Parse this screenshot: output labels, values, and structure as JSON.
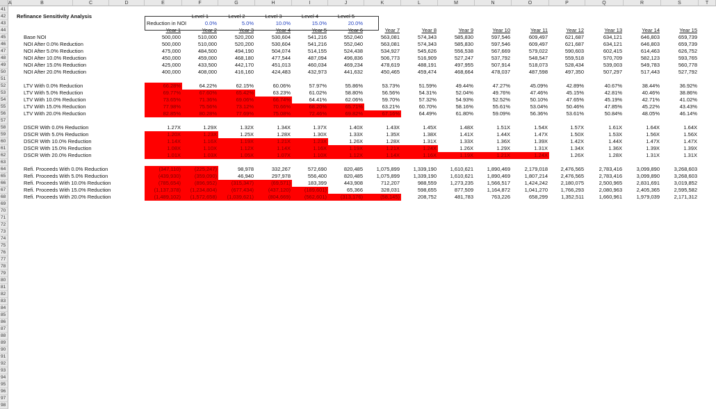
{
  "columns": [
    "A",
    "B",
    "C",
    "D",
    "E",
    "F",
    "G",
    "H",
    "I",
    "J",
    "K",
    "L",
    "M",
    "N",
    "O",
    "P",
    "Q",
    "R",
    "S",
    "T"
  ],
  "row_numbers": [
    41,
    42,
    43,
    44,
    45,
    46,
    47,
    48,
    49,
    50,
    51,
    52,
    53,
    54,
    55,
    56,
    57,
    58,
    59,
    60,
    61,
    62,
    63,
    64,
    65,
    66,
    67,
    68,
    69,
    70,
    71,
    72,
    73,
    74,
    75,
    76,
    77,
    78,
    79,
    80,
    81,
    82,
    83,
    84,
    85,
    86,
    87,
    88,
    89,
    90,
    91,
    92,
    93,
    94,
    95,
    96,
    97,
    98
  ],
  "title": "Refinance Sensitivity Analysis",
  "levels": [
    "Level 1",
    "Level 2",
    "Level 3",
    "Level 4",
    "Level 5"
  ],
  "reduction_label": "Reduction in NOI",
  "reduction_values": [
    "0.0%",
    "5.0%",
    "10.0%",
    "15.0%",
    "20.0%"
  ],
  "years": [
    "Year 1",
    "Year 2",
    "Year 3",
    "Year 4",
    "Year 5",
    "Year 6",
    "Year 7",
    "Year 8",
    "Year 9",
    "Year 10",
    "Year 11",
    "Year 12",
    "Year 13",
    "Year 14",
    "Year 15"
  ],
  "sections": [
    {
      "rows": [
        {
          "label": "Base NOI",
          "values": [
            "500,000",
            "510,000",
            "520,200",
            "530,604",
            "541,216",
            "552,040",
            "563,081",
            "574,343",
            "585,830",
            "597,546",
            "609,497",
            "621,687",
            "634,121",
            "646,803",
            "659,739"
          ],
          "hl": 0
        },
        {
          "label": "NOI After 0.0% Reduction",
          "values": [
            "500,000",
            "510,000",
            "520,200",
            "530,604",
            "541,216",
            "552,040",
            "563,081",
            "574,343",
            "585,830",
            "597,546",
            "609,497",
            "621,687",
            "634,121",
            "646,803",
            "659,739"
          ],
          "hl": 0
        },
        {
          "label": "NOI After 5.0% Reduction",
          "values": [
            "475,000",
            "484,500",
            "494,190",
            "504,074",
            "514,155",
            "524,438",
            "534,927",
            "545,626",
            "556,538",
            "567,669",
            "579,022",
            "590,603",
            "602,415",
            "614,463",
            "626,752"
          ],
          "hl": 0
        },
        {
          "label": "NOI After 10.0% Reduction",
          "values": [
            "450,000",
            "459,000",
            "468,180",
            "477,544",
            "487,094",
            "496,836",
            "506,773",
            "516,909",
            "527,247",
            "537,792",
            "548,547",
            "559,518",
            "570,709",
            "582,123",
            "593,765"
          ],
          "hl": 0
        },
        {
          "label": "NOI After 15.0% Reduction",
          "values": [
            "425,000",
            "433,500",
            "442,170",
            "451,013",
            "460,034",
            "469,234",
            "478,619",
            "488,191",
            "497,955",
            "507,914",
            "518,073",
            "528,434",
            "539,003",
            "549,783",
            "560,778"
          ],
          "hl": 0
        },
        {
          "label": "NOI After 20.0% Reduction",
          "values": [
            "400,000",
            "408,000",
            "416,160",
            "424,483",
            "432,973",
            "441,632",
            "450,465",
            "459,474",
            "468,664",
            "478,037",
            "487,598",
            "497,350",
            "507,297",
            "517,443",
            "527,792"
          ],
          "hl": 0
        }
      ]
    },
    {
      "rows": [
        {
          "label": "LTV With 0.0% Reduction",
          "values": [
            "66.28%",
            "64.22%",
            "62.15%",
            "60.06%",
            "57.97%",
            "55.86%",
            "53.73%",
            "51.59%",
            "49.44%",
            "47.27%",
            "45.09%",
            "42.89%",
            "40.67%",
            "38.44%",
            "36.92%"
          ],
          "hl": 1
        },
        {
          "label": "LTV With 5.0% Reduction",
          "values": [
            "69.77%",
            "67.60%",
            "65.42%",
            "63.23%",
            "61.02%",
            "58.80%",
            "56.56%",
            "54.31%",
            "52.04%",
            "49.76%",
            "47.46%",
            "45.15%",
            "42.81%",
            "40.46%",
            "38.86%"
          ],
          "hl": 3
        },
        {
          "label": "LTV With 10.0% Reduction",
          "values": [
            "73.65%",
            "71.36%",
            "69.06%",
            "66.74%",
            "64.41%",
            "62.06%",
            "59.70%",
            "57.32%",
            "54.93%",
            "52.52%",
            "50.10%",
            "47.65%",
            "45.19%",
            "42.71%",
            "41.02%"
          ],
          "hl": 4
        },
        {
          "label": "LTV With 15.0% Reduction",
          "values": [
            "77.98%",
            "75.56%",
            "73.12%",
            "70.66%",
            "68.20%",
            "65.71%",
            "63.21%",
            "60.70%",
            "58.16%",
            "55.61%",
            "53.04%",
            "50.46%",
            "47.85%",
            "45.22%",
            "43.43%"
          ],
          "hl": 6
        },
        {
          "label": "LTV With 20.0% Reduction",
          "values": [
            "82.85%",
            "80.28%",
            "77.69%",
            "75.08%",
            "72.46%",
            "69.82%",
            "67.16%",
            "64.49%",
            "61.80%",
            "59.09%",
            "56.36%",
            "53.61%",
            "50.84%",
            "48.05%",
            "46.14%"
          ],
          "hl": 7
        }
      ]
    },
    {
      "rows": [
        {
          "label": "DSCR With 0.0% Reduction",
          "values": [
            "1.27X",
            "1.29X",
            "1.32X",
            "1.34X",
            "1.37X",
            "1.40X",
            "1.43X",
            "1.45X",
            "1.48X",
            "1.51X",
            "1.54X",
            "1.57X",
            "1.61X",
            "1.64X",
            "1.64X"
          ],
          "hl": 0
        },
        {
          "label": "DSCR With 5.0% Reduction",
          "values": [
            "1.20X",
            "1.23X",
            "1.25X",
            "1.28X",
            "1.30X",
            "1.33X",
            "1.35X",
            "1.38X",
            "1.41X",
            "1.44X",
            "1.47X",
            "1.50X",
            "1.53X",
            "1.56X",
            "1.56X"
          ],
          "hl": 2
        },
        {
          "label": "DSCR With 10.0% Reduction",
          "values": [
            "1.14X",
            "1.16X",
            "1.19X",
            "1.21X",
            "1.23X",
            "1.26X",
            "1.28X",
            "1.31X",
            "1.33X",
            "1.36X",
            "1.39X",
            "1.42X",
            "1.44X",
            "1.47X",
            "1.47X"
          ],
          "hl": 5
        },
        {
          "label": "DSCR With 15.0% Reduction",
          "values": [
            "1.08X",
            "1.10X",
            "1.12X",
            "1.14X",
            "1.16X",
            "1.19X",
            "1.21X",
            "1.24X",
            "1.26X",
            "1.29X",
            "1.31X",
            "1.34X",
            "1.36X",
            "1.39X",
            "1.39X"
          ],
          "hl": 8
        },
        {
          "label": "DSCR With 20.0% Reduction",
          "values": [
            "1.01X",
            "1.03X",
            "1.05X",
            "1.07X",
            "1.10X",
            "1.12X",
            "1.14X",
            "1.16X",
            "1.19X",
            "1.21X",
            "1.24X",
            "1.26X",
            "1.28X",
            "1.31X",
            "1.31X"
          ],
          "hl": 11
        }
      ]
    },
    {
      "rows": [
        {
          "label": "Refi. Proceeds With 0.0% Reduction",
          "values": [
            "(347,110)",
            "(225,247)",
            "98,978",
            "332,267",
            "572,690",
            "820,485",
            "1,075,899",
            "1,339,190",
            "1,610,621",
            "1,890,469",
            "2,179,018",
            "2,476,565",
            "2,783,416",
            "3,099,890",
            "3,268,603"
          ],
          "hl": 2
        },
        {
          "label": "Refi. Proceeds With 5.0% Reduction",
          "values": [
            "(439,930)",
            "(359,090)",
            "46,940",
            "297,978",
            "556,400",
            "820,485",
            "1,075,899",
            "1,339,190",
            "1,610,621",
            "1,890,469",
            "1,807,214",
            "2,476,565",
            "2,783,416",
            "3,099,890",
            "3,268,603"
          ],
          "hl": 2
        },
        {
          "label": "Refi. Proceeds With 10.0% Reduction",
          "values": [
            "(785,654)",
            "(896,952)",
            "(315,347)",
            "(69,571)",
            "183,399",
            "443,908",
            "712,207",
            "988,559",
            "1,273,235",
            "1,566,517",
            "1,424,242",
            "2,180,075",
            "2,500,965",
            "2,831,691",
            "3,019,852"
          ],
          "hl": 4
        },
        {
          "label": "Refi. Proceeds With 15.0% Reduction",
          "values": [
            "(1,137,378)",
            "(1,234,804)",
            "(677,434)",
            "(437,120)",
            "(189,601)",
            "65,366",
            "328,031",
            "598,655",
            "877,509",
            "1,164,872",
            "1,041,270",
            "1,766,293",
            "2,080,963",
            "2,405,365",
            "2,595,582"
          ],
          "hl": 5
        },
        {
          "label": "Refi. Proceeds With 20.0% Reduction",
          "values": [
            "(1,489,102)",
            "(1,572,658)",
            "(1,039,621)",
            "(804,669)",
            "(562,601)",
            "(313,176)",
            "(58,145)",
            "208,752",
            "481,783",
            "763,226",
            "658,299",
            "1,352,511",
            "1,660,961",
            "1,979,039",
            "2,171,312"
          ],
          "hl": 7
        }
      ]
    }
  ],
  "colors": {
    "highlight": "#ff0000",
    "highlight_text": "#7a0000",
    "level_value": "#1f3fbf",
    "header_bg": "#e8e8e8"
  }
}
